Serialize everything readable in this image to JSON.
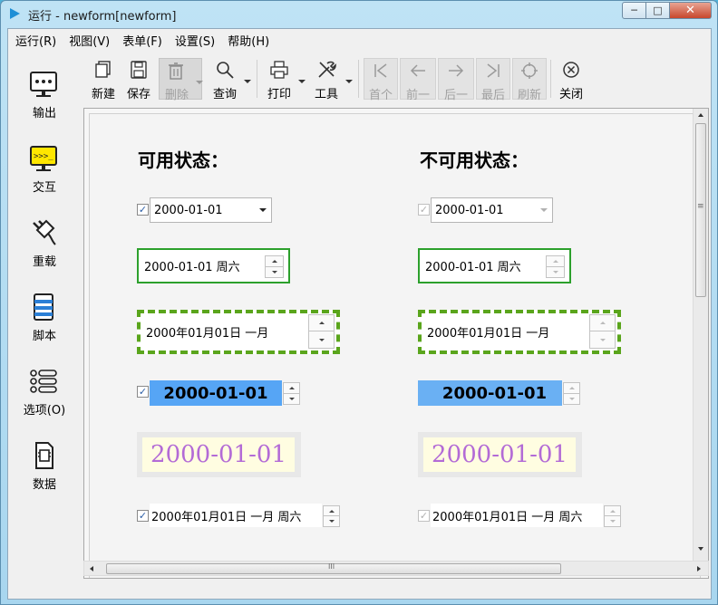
{
  "window": {
    "title": "运行 - newform[newform]",
    "min": "─",
    "max": "□",
    "close": "✕"
  },
  "menubar": {
    "items": [
      "运行(R)",
      "视图(V)",
      "表单(F)",
      "设置(S)",
      "帮助(H)"
    ]
  },
  "sidebar": {
    "items": [
      {
        "label": "输出",
        "icon": "monitor-icon"
      },
      {
        "label": "交互",
        "icon": "terminal-icon"
      },
      {
        "label": "重载",
        "icon": "plug-icon"
      },
      {
        "label": "脚本",
        "icon": "script-icon"
      },
      {
        "label": "选项(O)",
        "icon": "list-icon"
      },
      {
        "label": "数据",
        "icon": "chip-icon"
      }
    ]
  },
  "toolbar": {
    "new": "新建",
    "save": "保存",
    "delete": "删除",
    "query": "查询",
    "print": "打印",
    "tools": "工具",
    "first": "首个",
    "prev": "前一",
    "next": "后一",
    "last": "最后",
    "refresh": "刷新",
    "close": "关闭"
  },
  "form": {
    "enabled_heading": "可用状态：",
    "disabled_heading": "不可用状态：",
    "check_mark": "✓",
    "enabled": {
      "date_combo": "2000-01-01",
      "date_weekday": "2000-01-01 周六",
      "date_cn_month": "2000年01月01日 一月",
      "bold_date": "2000-01-01",
      "big_date": "2000-01-01",
      "date_full": "2000年01月01日 一月 周六"
    },
    "disabled": {
      "date_combo": "2000-01-01",
      "date_weekday": "2000-01-01 周六",
      "date_cn_month": "2000年01月01日 一月",
      "bold_date": "2000-01-01",
      "big_date": "2000-01-01",
      "date_full": "2000年01月01日 一月 周六"
    }
  },
  "scrollbar": {
    "grip": "≡",
    "hgrip": "III"
  },
  "colors": {
    "accent_green": "#2ca02c",
    "dash_green": "#5aa51c",
    "bold_blue": "#56a5f5",
    "big_date_text": "#b36bd6",
    "big_date_bg": "#fffde1"
  }
}
